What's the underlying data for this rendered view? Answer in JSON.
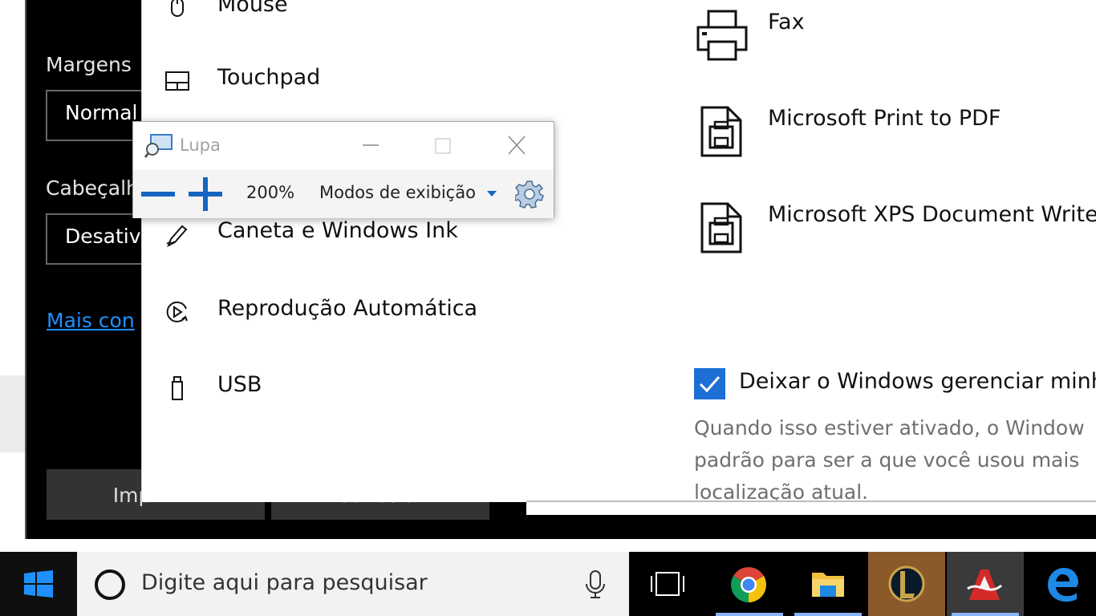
{
  "print_dialog": {
    "margins_label": "Margens",
    "margins_value": "Normal",
    "header_label": "Cabeçalh",
    "header_value": "Desativ",
    "more_settings_link": "Mais con",
    "print_button": "Imprimir",
    "cancel_button": "Cancelar"
  },
  "settings": {
    "nav": [
      {
        "label": "Mouse",
        "icon": "mouse-icon"
      },
      {
        "label": "Touchpad",
        "icon": "touchpad-icon"
      },
      {
        "label": "Caneta e Windows Ink",
        "icon": "pen-icon"
      },
      {
        "label": "Reprodução Automática",
        "icon": "autoplay-icon"
      },
      {
        "label": "USB",
        "icon": "usb-icon"
      }
    ],
    "printers": [
      {
        "label": "Fax",
        "icon": "fax-printer-icon"
      },
      {
        "label": "Microsoft Print to PDF",
        "icon": "printer-icon"
      },
      {
        "label": "Microsoft XPS Document Write",
        "icon": "printer-icon"
      }
    ],
    "manage_default": {
      "checked": true,
      "label": "Deixar o Windows gerenciar minh",
      "description_lines": [
        "Quando isso estiver ativado, o Window",
        "padrão para ser a que você usou mais",
        "localização atual."
      ]
    }
  },
  "magnifier": {
    "title": "Lupa",
    "zoom_level": "200%",
    "views_label": "Modos de exibição",
    "accent_color": "#1565c0"
  },
  "taskbar": {
    "search_placeholder": "Digite aqui para pesquisar",
    "apps": [
      "task-view-icon",
      "chrome-icon",
      "file-explorer-icon",
      "league-of-legends-icon",
      "adobe-acrobat-icon",
      "edge-icon"
    ]
  }
}
